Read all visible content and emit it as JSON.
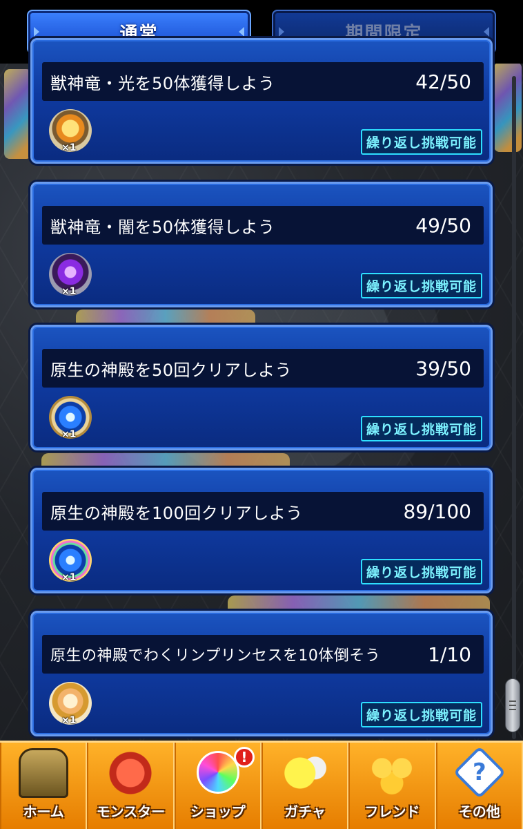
{
  "tabs": [
    {
      "label": "通常",
      "active": true
    },
    {
      "label": "期間限定",
      "active": false
    }
  ],
  "missions": [
    {
      "title": "獣神竜・光を50体獲得しよう",
      "progress": "42/50",
      "reward_icon": "light-dragon-icon",
      "reward_count": "×1",
      "badge": "繰り返し挑戦可能"
    },
    {
      "title": "獣神竜・闇を50体獲得しよう",
      "progress": "49/50",
      "reward_icon": "dark-dragon-icon",
      "reward_count": "×1",
      "badge": "繰り返し挑戦可能"
    },
    {
      "title": "原生の神殿を50回クリアしよう",
      "progress": "39/50",
      "reward_icon": "medal-icon",
      "reward_count": "×1",
      "badge": "繰り返し挑戦可能"
    },
    {
      "title": "原生の神殿を100回クリアしよう",
      "progress": "89/100",
      "reward_icon": "rainbow-medal-icon",
      "reward_count": "×1",
      "badge": "繰り返し挑戦可能"
    },
    {
      "title": "原生の神殿でわくリンプリンセスを10体倒そう",
      "progress": "1/10",
      "reward_icon": "character-icon",
      "reward_count": "×1",
      "badge": "繰り返し挑戦可能"
    }
  ],
  "bottom_nav": [
    {
      "label": "ホーム",
      "icon": "home-icon"
    },
    {
      "label": "モンスター",
      "icon": "monster-icon"
    },
    {
      "label": "ショップ",
      "icon": "shop-orb-icon",
      "alert": "!"
    },
    {
      "label": "ガチャ",
      "icon": "gacha-egg-icon"
    },
    {
      "label": "フレンド",
      "icon": "friend-icon"
    },
    {
      "label": "その他",
      "icon": "question-icon",
      "glyph": "?"
    }
  ],
  "colors": {
    "tab_active": "#1f5ce0",
    "card_bg": "#0f3aa0",
    "badge_border": "#2ee0ff",
    "nav_bg": "#f29a10"
  }
}
